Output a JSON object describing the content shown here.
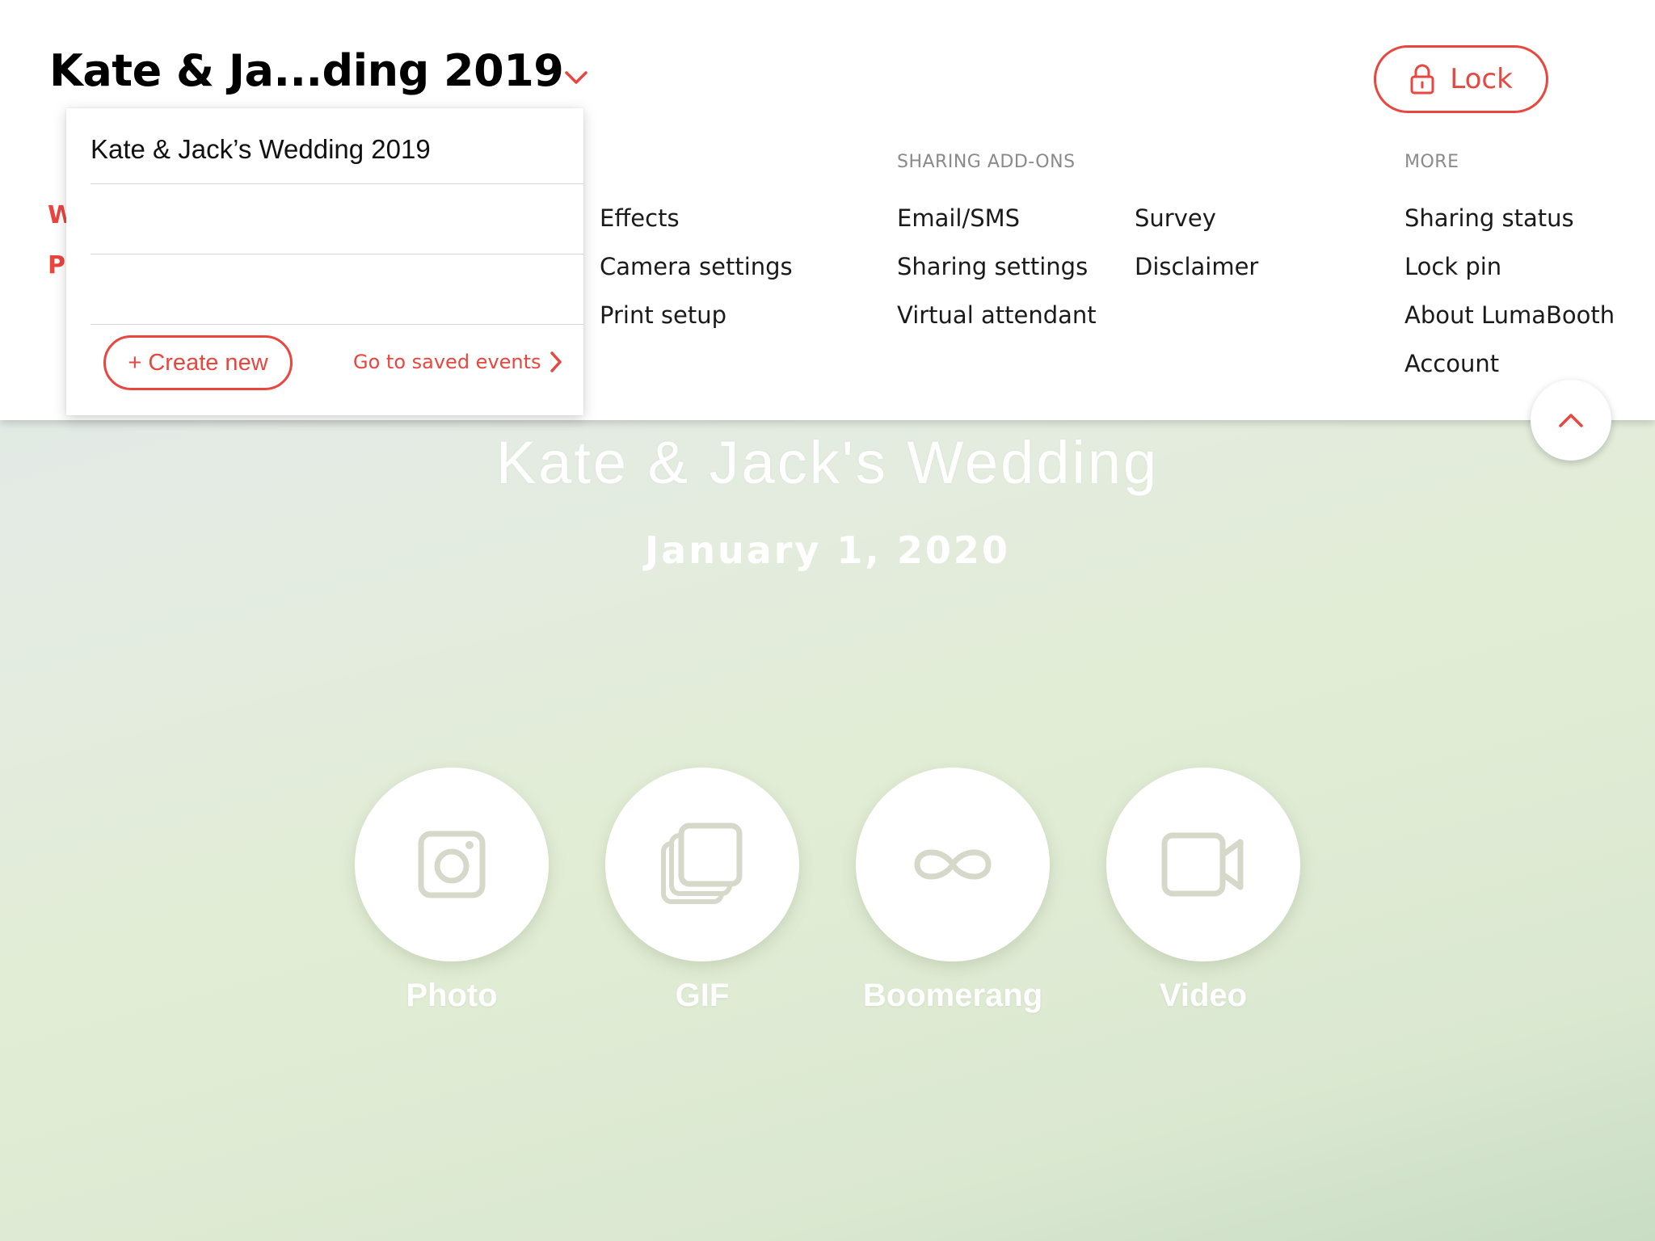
{
  "header": {
    "event_title": "Kate & Ja...ding 2019",
    "lock_label": "Lock"
  },
  "dropdown": {
    "items": [
      "Kate & Jack’s Wedding 2019",
      "",
      ""
    ],
    "create_new_label": "+ Create new",
    "saved_events_label": "Go to saved events"
  },
  "menu": {
    "peek_letters": [
      "W",
      "P"
    ],
    "column_setup": [
      "Effects",
      "Camera settings",
      "Print setup"
    ],
    "sharing_addons": {
      "heading": "SHARING ADD-ONS",
      "col1": [
        "Email/SMS",
        "Sharing settings",
        "Virtual attendant"
      ],
      "col2": [
        "Survey",
        "Disclaimer"
      ]
    },
    "more": {
      "heading": "MORE",
      "items": [
        "Sharing status",
        "Lock pin",
        "About LumaBooth",
        "Account"
      ]
    }
  },
  "welcome": {
    "title": "Kate & Jack's Wedding",
    "date": "January 1, 2020"
  },
  "modes": [
    {
      "label": "Photo",
      "icon": "camera-icon"
    },
    {
      "label": "GIF",
      "icon": "stacked-frames-icon"
    },
    {
      "label": "Boomerang",
      "icon": "infinity-icon"
    },
    {
      "label": "Video",
      "icon": "video-camera-icon"
    }
  ],
  "colors": {
    "accent": "#e8463f",
    "icon_gray": "#d6d8ca",
    "panel_bg": "#ffffff"
  }
}
